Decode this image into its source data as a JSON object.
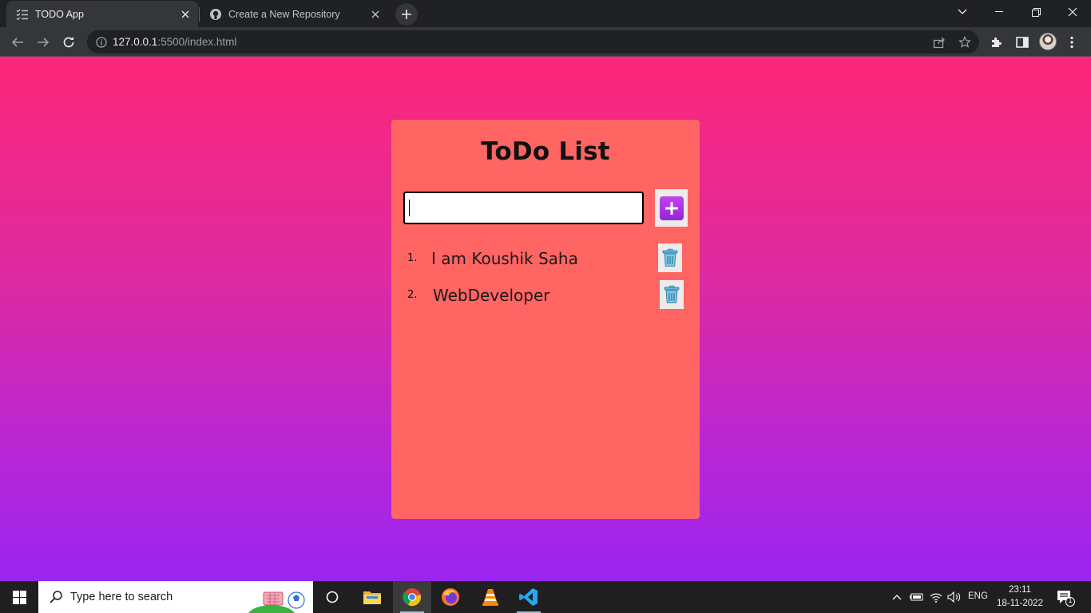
{
  "browser": {
    "tabs": [
      {
        "title": "TODO App",
        "active": true,
        "favicon": "checklist-icon"
      },
      {
        "title": "Create a New Repository",
        "active": false,
        "favicon": "github-icon"
      }
    ],
    "url": {
      "host": "127.0.0.1",
      "rest": ":5500/index.html"
    }
  },
  "app": {
    "title": "ToDo List",
    "input": {
      "value": "",
      "placeholder": ""
    },
    "add_button_icon": "plus-icon",
    "items": [
      {
        "number": "1.",
        "text": "I am Koushik Saha",
        "delete_icon": "trash-icon"
      },
      {
        "number": "2.",
        "text": "WebDeveloper",
        "delete_icon": "trash-icon"
      }
    ],
    "colors": {
      "card": "#ff6562",
      "gradient_top": "#fd2779",
      "gradient_bottom": "#9a25f1",
      "add_button": "#b132e6"
    }
  },
  "taskbar": {
    "search_placeholder": "Type here to search",
    "tray": {
      "language": "ENG",
      "time": "23:11",
      "date": "18-11-2022",
      "notification_count": "1"
    }
  }
}
